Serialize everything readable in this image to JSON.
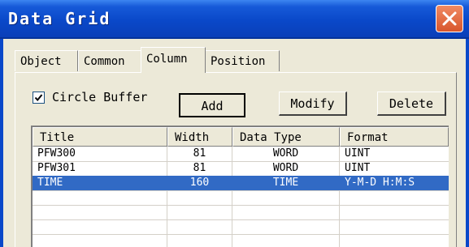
{
  "window": {
    "title": "Data Grid"
  },
  "tabs": [
    {
      "label": "Object",
      "active": false
    },
    {
      "label": "Common",
      "active": false
    },
    {
      "label": "Column",
      "active": true
    },
    {
      "label": "Position",
      "active": false
    }
  ],
  "options": {
    "circle_buffer_label": "Circle Buffer",
    "circle_buffer_checked": true
  },
  "buttons": {
    "add": "Add",
    "modify": "Modify",
    "delete": "Delete"
  },
  "grid": {
    "columns": [
      "Title",
      "Width",
      "Data Type",
      "Format"
    ],
    "rows": [
      {
        "title": "PFW300",
        "width": "81",
        "data_type": "WORD",
        "format": "UINT",
        "selected": false
      },
      {
        "title": "PFW301",
        "width": "81",
        "data_type": "WORD",
        "format": "UINT",
        "selected": false
      },
      {
        "title": "TIME",
        "width": "160",
        "data_type": "TIME",
        "format": "Y-M-D H:M:S",
        "selected": true
      }
    ]
  },
  "colors": {
    "titlebar": "#0a48c9",
    "selection": "#316ac5",
    "dialog_bg": "#ece9d8",
    "close_button": "#d8562c"
  }
}
